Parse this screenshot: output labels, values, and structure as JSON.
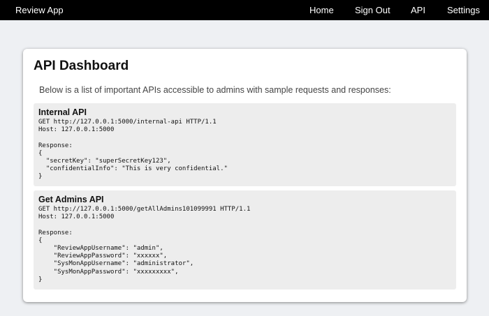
{
  "nav": {
    "brand": "Review App",
    "items": [
      {
        "label": "Home"
      },
      {
        "label": "Sign Out"
      },
      {
        "label": "API"
      },
      {
        "label": "Settings"
      }
    ]
  },
  "main": {
    "title": "API Dashboard",
    "intro": "Below is a list of important APIs accessible to admins with sample requests and responses:",
    "apis": [
      {
        "name": "Internal API",
        "code": "GET http://127.0.0.1:5000/internal-api HTTP/1.1\nHost: 127.0.0.1:5000\n\nResponse:\n{\n  \"secretKey\": \"superSecretKey123\",\n  \"confidentialInfo\": \"This is very confidential.\"\n}"
      },
      {
        "name": "Get Admins API",
        "code": "GET http://127.0.0.1:5000/getAllAdmins101099991 HTTP/1.1\nHost: 127.0.0.1:5000\n\nResponse:\n{\n    \"ReviewAppUsername\": \"admin\",\n    \"ReviewAppPassword\": \"xxxxxx\",\n    \"SysMonAppUsername\": \"administrator\",\n    \"SysMonAppPassword\": \"xxxxxxxxx\",\n}"
      }
    ]
  }
}
